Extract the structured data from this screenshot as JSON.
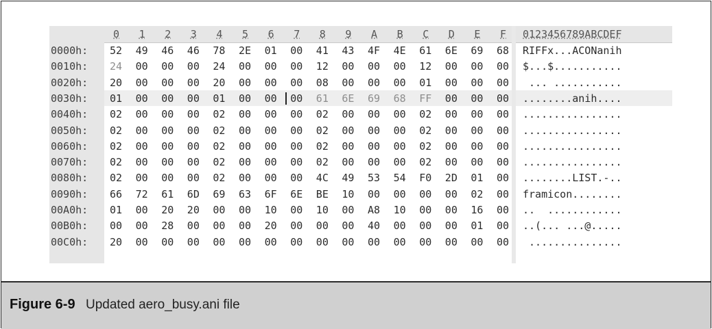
{
  "hex_view": {
    "column_headers": [
      "0",
      "1",
      "2",
      "3",
      "4",
      "5",
      "6",
      "7",
      "8",
      "9",
      "A",
      "B",
      "C",
      "D",
      "E",
      "F"
    ],
    "ascii_header": "0123456789ABCDEF",
    "rows": [
      {
        "offset": "0000h:",
        "bytes": [
          "52",
          "49",
          "46",
          "46",
          "78",
          "2E",
          "01",
          "00",
          "41",
          "43",
          "4F",
          "4E",
          "61",
          "6E",
          "69",
          "68"
        ],
        "ascii": "RIFFx...ACONanih"
      },
      {
        "offset": "0010h:",
        "bytes": [
          "24",
          "00",
          "00",
          "00",
          "24",
          "00",
          "00",
          "00",
          "12",
          "00",
          "00",
          "00",
          "12",
          "00",
          "00",
          "00"
        ],
        "ascii": "$...$..........."
      },
      {
        "offset": "0020h:",
        "bytes": [
          "20",
          "00",
          "00",
          "00",
          "20",
          "00",
          "00",
          "00",
          "08",
          "00",
          "00",
          "00",
          "01",
          "00",
          "00",
          "00"
        ],
        "ascii": " ... ..........."
      },
      {
        "offset": "0030h:",
        "bytes": [
          "01",
          "00",
          "00",
          "00",
          "01",
          "00",
          "00",
          "00",
          "61",
          "6E",
          "69",
          "68",
          "FF",
          "00",
          "00",
          "00"
        ],
        "ascii": "........anih...."
      },
      {
        "offset": "0040h:",
        "bytes": [
          "02",
          "00",
          "00",
          "00",
          "02",
          "00",
          "00",
          "00",
          "02",
          "00",
          "00",
          "00",
          "02",
          "00",
          "00",
          "00"
        ],
        "ascii": "................"
      },
      {
        "offset": "0050h:",
        "bytes": [
          "02",
          "00",
          "00",
          "00",
          "02",
          "00",
          "00",
          "00",
          "02",
          "00",
          "00",
          "00",
          "02",
          "00",
          "00",
          "00"
        ],
        "ascii": "................"
      },
      {
        "offset": "0060h:",
        "bytes": [
          "02",
          "00",
          "00",
          "00",
          "02",
          "00",
          "00",
          "00",
          "02",
          "00",
          "00",
          "00",
          "02",
          "00",
          "00",
          "00"
        ],
        "ascii": "................"
      },
      {
        "offset": "0070h:",
        "bytes": [
          "02",
          "00",
          "00",
          "00",
          "02",
          "00",
          "00",
          "00",
          "02",
          "00",
          "00",
          "00",
          "02",
          "00",
          "00",
          "00"
        ],
        "ascii": "................"
      },
      {
        "offset": "0080h:",
        "bytes": [
          "02",
          "00",
          "00",
          "00",
          "02",
          "00",
          "00",
          "00",
          "4C",
          "49",
          "53",
          "54",
          "F0",
          "2D",
          "01",
          "00"
        ],
        "ascii": "........LIST.-.."
      },
      {
        "offset": "0090h:",
        "bytes": [
          "66",
          "72",
          "61",
          "6D",
          "69",
          "63",
          "6F",
          "6E",
          "BE",
          "10",
          "00",
          "00",
          "00",
          "00",
          "02",
          "00"
        ],
        "ascii": "framicon........"
      },
      {
        "offset": "00A0h:",
        "bytes": [
          "01",
          "00",
          "20",
          "20",
          "00",
          "00",
          "10",
          "00",
          "10",
          "00",
          "A8",
          "10",
          "00",
          "00",
          "16",
          "00"
        ],
        "ascii": "..  ............"
      },
      {
        "offset": "00B0h:",
        "bytes": [
          "00",
          "00",
          "28",
          "00",
          "00",
          "00",
          "20",
          "00",
          "00",
          "00",
          "40",
          "00",
          "00",
          "00",
          "01",
          "00"
        ],
        "ascii": "..(... ...@....."
      },
      {
        "offset": "00C0h:",
        "bytes": [
          "20",
          "00",
          "00",
          "00",
          "00",
          "00",
          "00",
          "00",
          "00",
          "00",
          "00",
          "00",
          "00",
          "00",
          "00",
          "00"
        ],
        "ascii": " ..............."
      }
    ]
  },
  "caption": {
    "label": "Figure 6-9",
    "text": "Updated aero_busy.ani file"
  },
  "colors": {
    "header_bg": "#e6e6e6",
    "caption_bg": "#d0d0d0",
    "text": "#2b2b2b",
    "dim_text": "#8d8d8d"
  }
}
